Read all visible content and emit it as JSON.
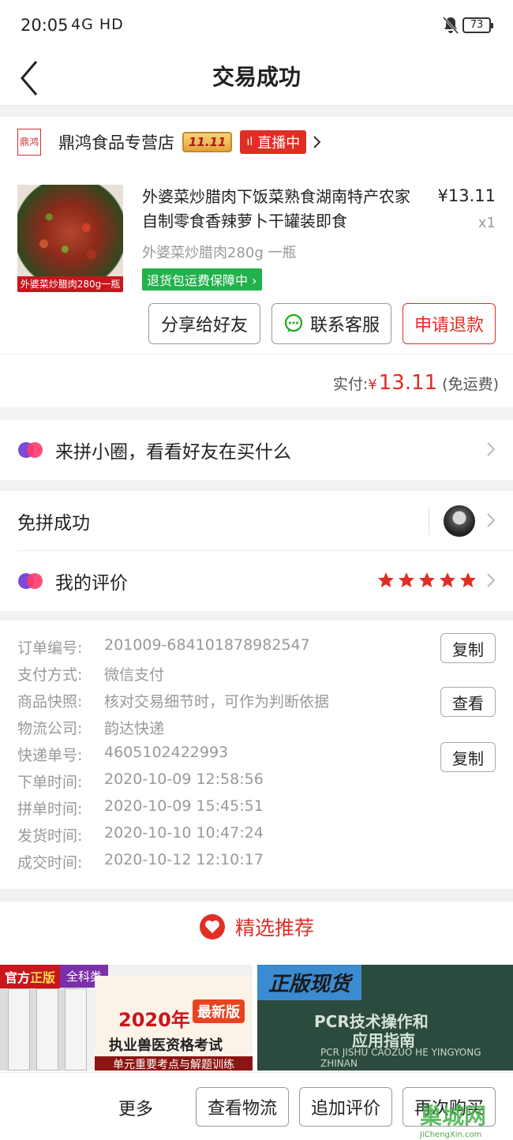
{
  "status_bar": {
    "time": "20:05",
    "network": "4G HD",
    "battery": "73"
  },
  "nav": {
    "title": "交易成功"
  },
  "shop": {
    "logo_text": "鼎鸿",
    "name": "鼎鸿食品专营店",
    "badge_1111": "11.11",
    "live_badge": "直播中"
  },
  "product": {
    "image_label": "外婆菜炒腊肉280g一瓶",
    "title": "外婆菜炒腊肉下饭菜熟食湖南特产农家自制零食香辣萝卜干罐装即食",
    "price": "¥13.11",
    "quantity": "x1",
    "spec": "外婆菜炒腊肉280g 一瓶",
    "guarantee": "退货包运费保障中"
  },
  "actions": {
    "share": "分享给好友",
    "contact": "联系客服",
    "refund": "申请退款"
  },
  "payment": {
    "label": "实付:",
    "currency": "¥",
    "amount": "13.11",
    "shipping_note": "(免运费)"
  },
  "rows": {
    "circle": "来拼小圈，看看好友在买什么",
    "group_success": "免拼成功",
    "review": "我的评价",
    "review_stars": 5
  },
  "order_info": [
    {
      "key": "订单编号:",
      "value": "201009-684101878982547",
      "button": "复制"
    },
    {
      "key": "支付方式:",
      "value": "微信支付"
    },
    {
      "key": "商品快照:",
      "value": "核对交易细节时，可作为判断依据",
      "button": "查看"
    },
    {
      "key": "物流公司:",
      "value": "韵达快递"
    },
    {
      "key": "快递单号:",
      "value": "4605102422993",
      "button": "复制"
    },
    {
      "key": "下单时间:",
      "value": "2020-10-09 12:58:56"
    },
    {
      "key": "拼单时间:",
      "value": "2020-10-09 15:45:51"
    },
    {
      "key": "发货时间:",
      "value": "2020-10-10 10:47:24"
    },
    {
      "key": "成交时间:",
      "value": "2020-10-12 12:10:17"
    }
  ],
  "recommend": {
    "title": "精选推荐",
    "item1": {
      "tag_official": "官方",
      "tag_genuine": "正版",
      "tag_all": "全科类",
      "year": "2020年",
      "edition": "最新版",
      "exam": "执业兽医资格考试",
      "subtitle": "单元重要考点与解题训练"
    },
    "item2": {
      "tag": "正版现货",
      "title_line1": "PCR技术操作和",
      "title_line2": "应用指南",
      "english": "PCR JISHU CAOZUO HE YINGYONG ZHINAN"
    }
  },
  "bottom_bar": {
    "more": "更多",
    "logistics": "查看物流",
    "add_review": "追加评价",
    "rebuy": "再次购买"
  },
  "watermark": {
    "text": "巢城网",
    "url": "JiChengXin.com"
  },
  "colors": {
    "accent": "#e02e24",
    "green": "#22b14c",
    "background": "#f2f2f2"
  }
}
